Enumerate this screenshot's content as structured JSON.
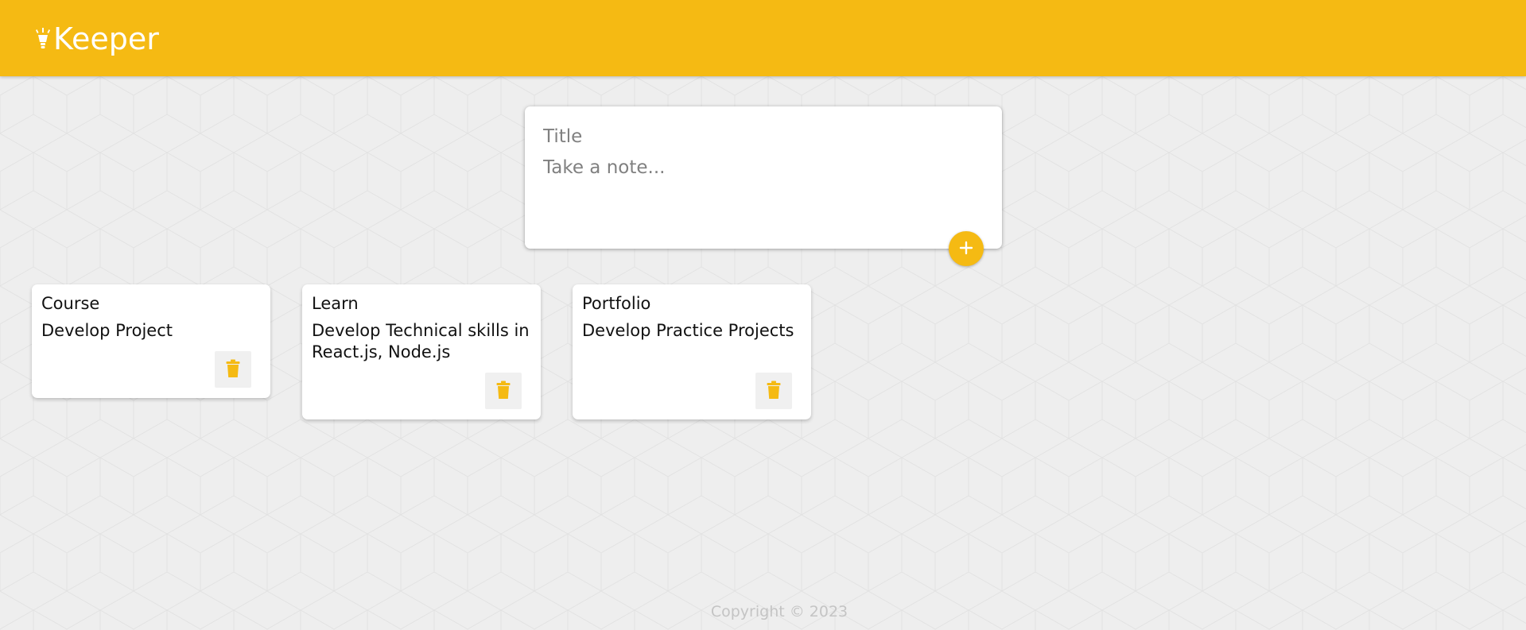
{
  "colors": {
    "accent": "#f5ba13",
    "page_background": "#eeeeee",
    "card_background": "#ffffff",
    "delete_button_background": "#f0f0f0",
    "footer_text": "#c4c4c4"
  },
  "header": {
    "brand_icon": "lightbulb-icon",
    "brand_name": "Keeper"
  },
  "composer": {
    "title_placeholder": "Title",
    "content_placeholder": "Take a note...",
    "title_value": "",
    "content_value": "",
    "add_icon": "plus-icon"
  },
  "notes": [
    {
      "title": "Course",
      "content": "Develop Project",
      "delete_icon": "trash-icon"
    },
    {
      "title": "Learn",
      "content": "Develop Technical skills in React.js, Node.js",
      "delete_icon": "trash-icon"
    },
    {
      "title": "Portfolio",
      "content": "Develop Practice Projects",
      "delete_icon": "trash-icon"
    }
  ],
  "footer": {
    "copyright": "Copyright © 2023"
  }
}
